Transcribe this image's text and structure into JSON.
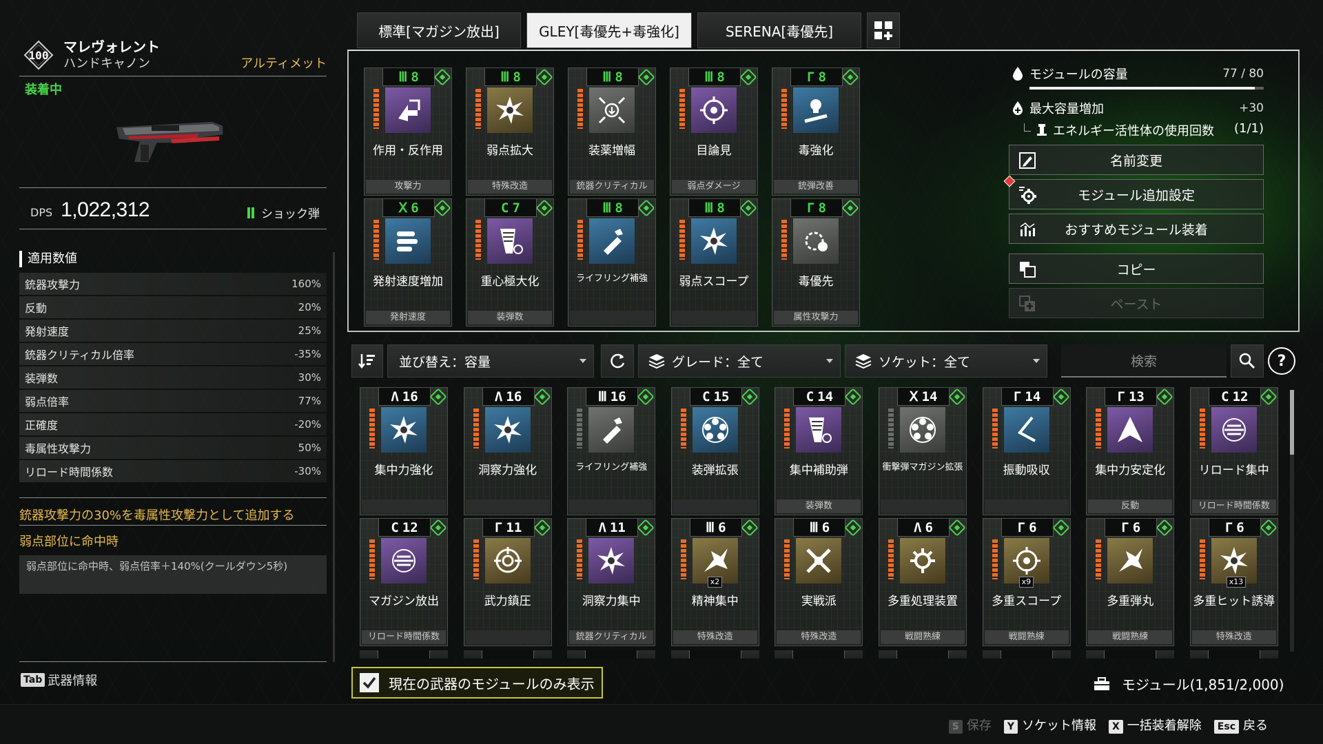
{
  "weapon": {
    "level": "100",
    "name": "マレヴォレント",
    "type": "ハンドキャノン",
    "rarity": "アルティメット",
    "equipped": "装着中",
    "dps_label": "DPS",
    "dps_value": "1,022,312",
    "ammo": "ショック弾"
  },
  "stats": {
    "heading": "適用数値",
    "items": [
      {
        "name": "銃器攻撃力",
        "value": "160%"
      },
      {
        "name": "反動",
        "value": "20%"
      },
      {
        "name": "発射速度",
        "value": "25%"
      },
      {
        "name": "銃器クリティカル倍率",
        "value": "-35%"
      },
      {
        "name": "装弾数",
        "value": "30%"
      },
      {
        "name": "弱点倍率",
        "value": "77%"
      },
      {
        "name": "正確度",
        "value": "-20%"
      },
      {
        "name": "毒属性攻撃力",
        "value": "50%"
      },
      {
        "name": "リロード時間係数",
        "value": "-30%"
      }
    ],
    "bonus1": "銃器攻撃力の30%を毒属性攻撃力として追加する",
    "bonus2_title": "弱点部位に命中時",
    "bonus2_desc": "弱点部位に命中時、弱点倍率＋140%(クールダウン5秒)",
    "tab_key": "Tab",
    "tab_label": "武器情報"
  },
  "tabs": [
    "標準[マガジン放出]",
    "GLEY[毒優先+毒強化]",
    "SERENA[毒優先]"
  ],
  "active_tab": 1,
  "equipped_modules": [
    {
      "cost": "8",
      "pol": "Ⅲ",
      "name": "作用・反作用",
      "sub": "攻撃力",
      "icon": "arrows-icon",
      "color": "purple"
    },
    {
      "cost": "8",
      "pol": "Ⅲ",
      "name": "弱点拡大",
      "sub": "特殊改造",
      "icon": "burst-icon",
      "color": "gold"
    },
    {
      "cost": "8",
      "pol": "Ⅲ",
      "name": "装薬増幅",
      "sub": "銃器クリティカル",
      "icon": "compress-icon",
      "color": "gray"
    },
    {
      "cost": "8",
      "pol": "Ⅲ",
      "name": "目論見",
      "sub": "弱点ダメージ",
      "icon": "target-icon",
      "color": "purple"
    },
    {
      "cost": "8",
      "pol": "Γ",
      "name": "毒強化",
      "sub": "銃弾改善",
      "icon": "poison-icon",
      "color": "blue"
    },
    {
      "cost": "6",
      "pol": "Ⅹ",
      "name": "発射速度増加",
      "sub": "発射速度",
      "icon": "bullets-icon",
      "color": "blue"
    },
    {
      "cost": "7",
      "pol": "C",
      "name": "重心極大化",
      "sub": "装弾数",
      "icon": "mag-icon",
      "color": "purple"
    },
    {
      "cost": "8",
      "pol": "Ⅲ",
      "name": "ライフリング補強",
      "sub": "",
      "icon": "bullet-icon",
      "color": "blue"
    },
    {
      "cost": "8",
      "pol": "Ⅲ",
      "name": "弱点スコープ",
      "sub": "",
      "icon": "burst-icon",
      "color": "blue"
    },
    {
      "cost": "8",
      "pol": "Γ",
      "name": "毒優先",
      "sub": "属性攻撃力",
      "icon": "poison-gear-icon",
      "color": "gray"
    }
  ],
  "capacity": {
    "label": "モジュールの容量",
    "value": "77 / 80",
    "used": 77,
    "max": 80,
    "max_increase_label": "最大容量増加",
    "max_increase_value": "+30",
    "energy_label": "エネルギー活性体の使用回数",
    "energy_value": "(1/1)"
  },
  "actions": {
    "rename": "名前変更",
    "extra": "モジュール追加設定",
    "recommend": "おすすめモジュール装着",
    "copy": "コピー",
    "paste": "ペースト"
  },
  "filters": {
    "sort": "並び替え：容量",
    "grade": "グレード：全て",
    "socket": "ソケット：全て",
    "search_placeholder": "検索",
    "help": "?"
  },
  "inventory": [
    {
      "cost": "16",
      "pol": "Λ",
      "name": "集中力強化",
      "sub": "",
      "icon": "burst-icon",
      "color": "blue",
      "mult": ""
    },
    {
      "cost": "16",
      "pol": "Λ",
      "name": "洞察力強化",
      "sub": "",
      "icon": "burst-icon",
      "color": "blue",
      "mult": ""
    },
    {
      "cost": "16",
      "pol": "Ⅲ",
      "name": "ライフリング補強",
      "sub": "",
      "icon": "bullet-icon",
      "color": "gray",
      "mult": ""
    },
    {
      "cost": "15",
      "pol": "C",
      "name": "装弾拡張",
      "sub": "",
      "icon": "drum-icon",
      "color": "blue",
      "mult": ""
    },
    {
      "cost": "14",
      "pol": "C",
      "name": "集中補助弾",
      "sub": "装弾数",
      "icon": "mag-icon",
      "color": "purple",
      "mult": ""
    },
    {
      "cost": "14",
      "pol": "Ⅹ",
      "name": "衝撃弾マガジン拡張",
      "sub": "",
      "icon": "drum-icon",
      "color": "gray",
      "mult": ""
    },
    {
      "cost": "14",
      "pol": "Γ",
      "name": "振動吸収",
      "sub": "",
      "icon": "chevron-icon",
      "color": "blue",
      "mult": ""
    },
    {
      "cost": "13",
      "pol": "Γ",
      "name": "集中力安定化",
      "sub": "反動",
      "icon": "triangle-icon",
      "color": "purple",
      "mult": ""
    },
    {
      "cost": "12",
      "pol": "C",
      "name": "リロード集中",
      "sub": "リロード時間係数",
      "icon": "reload-icon",
      "color": "purple",
      "mult": ""
    },
    {
      "cost": "12",
      "pol": "C",
      "name": "マガジン放出",
      "sub": "リロード時間係数",
      "icon": "reload-icon",
      "color": "purple",
      "mult": ""
    },
    {
      "cost": "11",
      "pol": "Γ",
      "name": "武力鎮圧",
      "sub": "",
      "icon": "crosshair-icon",
      "color": "gold",
      "mult": ""
    },
    {
      "cost": "11",
      "pol": "Λ",
      "name": "洞察力集中",
      "sub": "銃器クリティカル",
      "icon": "burst-icon",
      "color": "purple",
      "mult": ""
    },
    {
      "cost": "6",
      "pol": "Ⅲ",
      "name": "精神集中",
      "sub": "特殊改造",
      "icon": "shatter-icon",
      "color": "gold",
      "mult": "x2"
    },
    {
      "cost": "6",
      "pol": "Ⅲ",
      "name": "実戦派",
      "sub": "特殊改造",
      "icon": "cross-icon",
      "color": "gold",
      "mult": ""
    },
    {
      "cost": "6",
      "pol": "Λ",
      "name": "多重処理装置",
      "sub": "戦闘熟練",
      "icon": "gear-icon",
      "color": "gold",
      "mult": ""
    },
    {
      "cost": "6",
      "pol": "Γ",
      "name": "多重スコープ",
      "sub": "戦闘熟練",
      "icon": "target-icon",
      "color": "gold",
      "mult": "x9"
    },
    {
      "cost": "6",
      "pol": "Γ",
      "name": "多重弾丸",
      "sub": "戦闘熟練",
      "icon": "shatter-icon",
      "color": "gold",
      "mult": ""
    },
    {
      "cost": "6",
      "pol": "Γ",
      "name": "多重ヒット誘導",
      "sub": "特殊改造",
      "icon": "burst-icon",
      "color": "gold",
      "mult": "x13"
    }
  ],
  "bottom": {
    "only_current": "現在の武器のモジュールのみ表示",
    "module_count": "モジュール(1,851/2,000)",
    "keys": [
      {
        "key": "S",
        "label": "保存",
        "enabled": false
      },
      {
        "key": "Y",
        "label": "ソケット情報",
        "enabled": true
      },
      {
        "key": "X",
        "label": "一括装着解除",
        "enabled": true
      },
      {
        "key": "Esc",
        "label": "戻る",
        "enabled": true
      }
    ]
  },
  "colors": {
    "accent_green": "#46d548",
    "gold": "#e8b94a",
    "energy_bar": "#f26a22"
  }
}
